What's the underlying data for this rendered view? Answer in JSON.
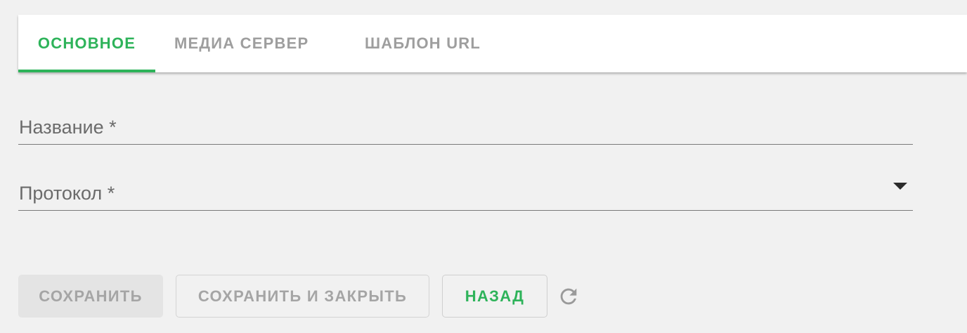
{
  "tabs": [
    {
      "label": "ОСНОВНОЕ",
      "active": true
    },
    {
      "label": "МЕДИА СЕРВЕР",
      "active": false
    },
    {
      "label": "ШАБЛОН URL",
      "active": false
    }
  ],
  "form": {
    "name_label": "Название *",
    "name_value": "",
    "protocol_label": "Протокол *",
    "protocol_value": ""
  },
  "actions": {
    "save_label": "СОХРАНИТЬ",
    "save_close_label": "СОХРАНИТЬ И ЗАКРЫТЬ",
    "back_label": "НАЗАД",
    "refresh_icon": "refresh-icon"
  },
  "colors": {
    "accent": "#2eb35a",
    "inactive_text": "#9e9e9e",
    "background": "#f1f1f1"
  }
}
